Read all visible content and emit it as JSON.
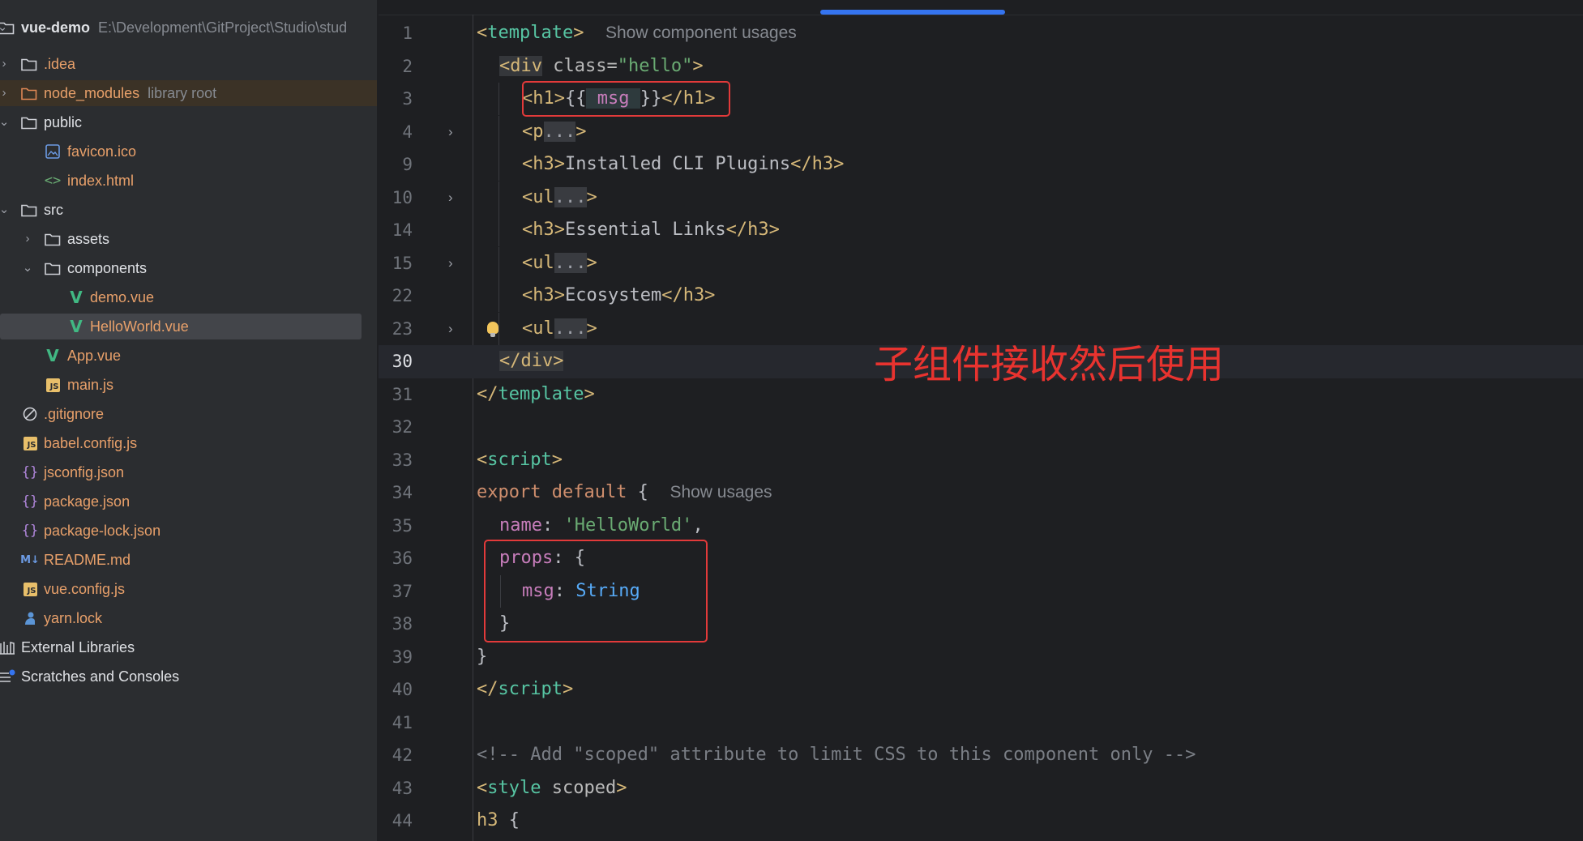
{
  "project": {
    "root_name": "vue-demo",
    "root_path": "E:\\Development\\GitProject\\Studio\\stud",
    "items": [
      {
        "label": "vue-demo",
        "hint": "E:\\Development\\GitProject\\Studio\\stud",
        "icon": "folder-icon"
      },
      {
        "label": ".idea",
        "icon": "folder-icon"
      },
      {
        "label": "node_modules",
        "hint": "library root",
        "icon": "folder-icon"
      },
      {
        "label": "public",
        "icon": "folder-icon"
      },
      {
        "label": "favicon.ico",
        "icon": "image-file-icon"
      },
      {
        "label": "index.html",
        "icon": "html-file-icon"
      },
      {
        "label": "src",
        "icon": "folder-icon"
      },
      {
        "label": "assets",
        "icon": "folder-icon"
      },
      {
        "label": "components",
        "icon": "folder-icon"
      },
      {
        "label": "demo.vue",
        "icon": "vue-file-icon"
      },
      {
        "label": "HelloWorld.vue",
        "icon": "vue-file-icon"
      },
      {
        "label": "App.vue",
        "icon": "vue-file-icon"
      },
      {
        "label": "main.js",
        "icon": "js-file-icon"
      },
      {
        "label": ".gitignore",
        "icon": "ignore-file-icon"
      },
      {
        "label": "babel.config.js",
        "icon": "js-file-icon"
      },
      {
        "label": "jsconfig.json",
        "icon": "json-file-icon"
      },
      {
        "label": "package.json",
        "icon": "json-file-icon"
      },
      {
        "label": "package-lock.json",
        "icon": "json-file-icon"
      },
      {
        "label": "README.md",
        "icon": "markdown-file-icon"
      },
      {
        "label": "vue.config.js",
        "icon": "js-file-icon"
      },
      {
        "label": "yarn.lock",
        "icon": "yarn-file-icon"
      },
      {
        "label": "External Libraries",
        "icon": "libraries-icon"
      },
      {
        "label": "Scratches and Consoles",
        "icon": "scratches-icon"
      }
    ],
    "js_badge": "JS",
    "md_badge": "M↓"
  },
  "editor": {
    "line_numbers": [
      "1",
      "2",
      "3",
      "4",
      "9",
      "10",
      "14",
      "15",
      "22",
      "23",
      "30",
      "31",
      "32",
      "33",
      "34",
      "35",
      "36",
      "37",
      "38",
      "39",
      "40",
      "41",
      "42",
      "43",
      "44"
    ],
    "line1": {
      "open": "<",
      "tag": "template",
      "close": ">",
      "inlay": "Show component usages"
    },
    "line2": {
      "open": "<div",
      "attr": " class=",
      "val": "\"hello\"",
      "close": ">"
    },
    "line3": {
      "open": "<h1>",
      "mustache_open": "{{",
      "var": " msg ",
      "mustache_close": "}}",
      "close": "</h1>"
    },
    "line4": {
      "open": "<p",
      "fold": "...",
      "close": ">"
    },
    "line9": {
      "open": "<h3>",
      "text": "Installed CLI Plugins",
      "close": "</h3>"
    },
    "line10": {
      "open": "<ul",
      "fold": "...",
      "close": ">"
    },
    "line14": {
      "open": "<h3>",
      "text": "Essential Links",
      "close": "</h3>"
    },
    "line15": {
      "open": "<ul",
      "fold": "...",
      "close": ">"
    },
    "line22": {
      "open": "<h3>",
      "text": "Ecosystem",
      "close": "</h3>"
    },
    "line23": {
      "open": "<ul",
      "fold": "...",
      "close": ">"
    },
    "line30": {
      "text": "</div>"
    },
    "line31": {
      "open": "</",
      "tag": "template",
      "close": ">"
    },
    "line33": {
      "open": "<",
      "tag": "script",
      "close": ">"
    },
    "line34": {
      "kw": "export default",
      "brace": " {",
      "inlay": "Show usages"
    },
    "line35": {
      "prop": "name",
      "colon": ": ",
      "val": "'HelloWorld'",
      "comma": ","
    },
    "line36": {
      "prop": "props",
      "rest": ": {"
    },
    "line37": {
      "prop": "msg",
      "colon": ": ",
      "type": "String"
    },
    "line38": {
      "text": "}"
    },
    "line39": {
      "text": "}"
    },
    "line40": {
      "open": "</",
      "tag": "script",
      "close": ">"
    },
    "line42": {
      "text": "<!-- Add \"scoped\" attribute to limit CSS to this component only -->"
    },
    "line43": {
      "open": "<",
      "tag": "style",
      "attr": " scoped",
      "close": ">"
    },
    "line44": {
      "sel": "h3",
      "brace": " {"
    }
  },
  "annotation": {
    "text": "子组件接收然后使用",
    "color": "#e8332f"
  },
  "colors": {
    "accent": "#3574f0",
    "highlight_box": "#e23a3a",
    "selection": "#43454a"
  }
}
